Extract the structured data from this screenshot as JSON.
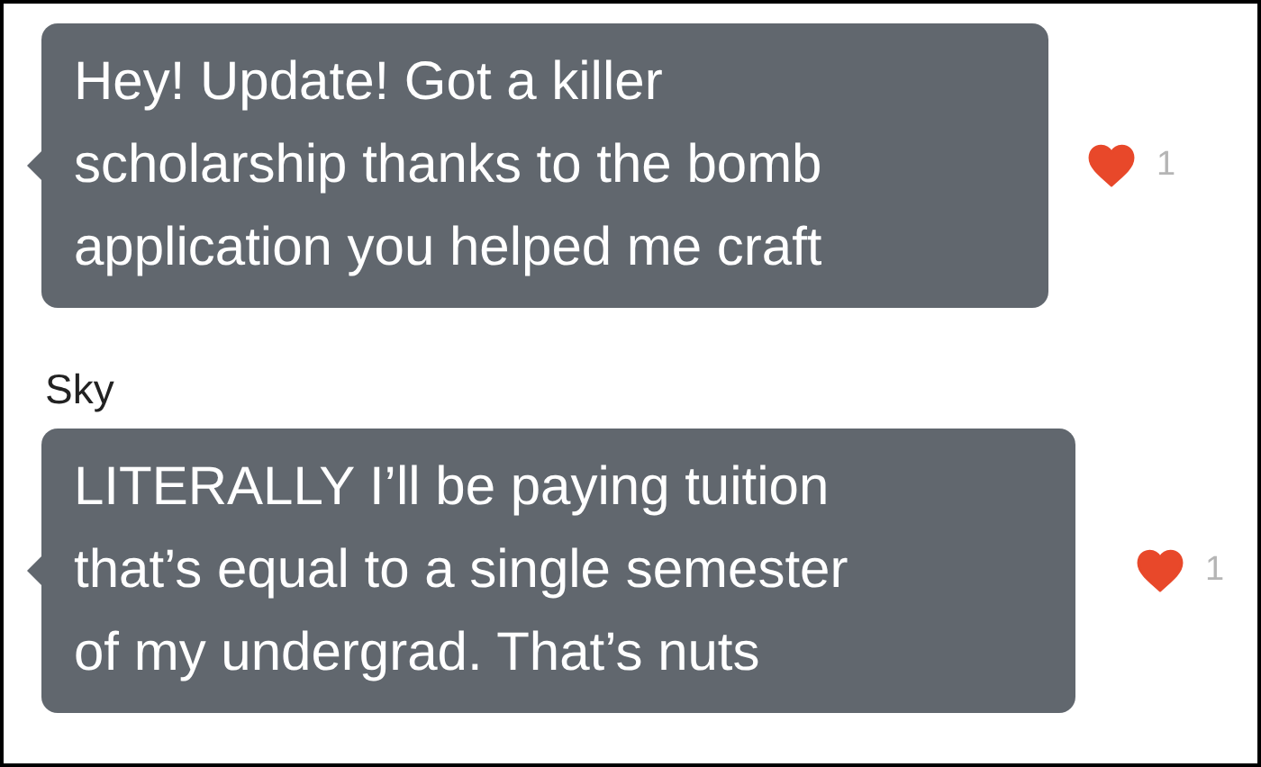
{
  "messages": [
    {
      "text": "Hey! Update! Got a killer\nscholarship thanks to the bomb\napplication you helped me craft",
      "reaction": {
        "liked": true,
        "count": "1"
      }
    },
    {
      "sender": "Sky",
      "text": "LITERALLY I’ll be paying tuition\nthat’s equal to a single semester\nof my undergrad. That’s nuts",
      "reaction": {
        "liked": true,
        "count": "1"
      }
    }
  ]
}
